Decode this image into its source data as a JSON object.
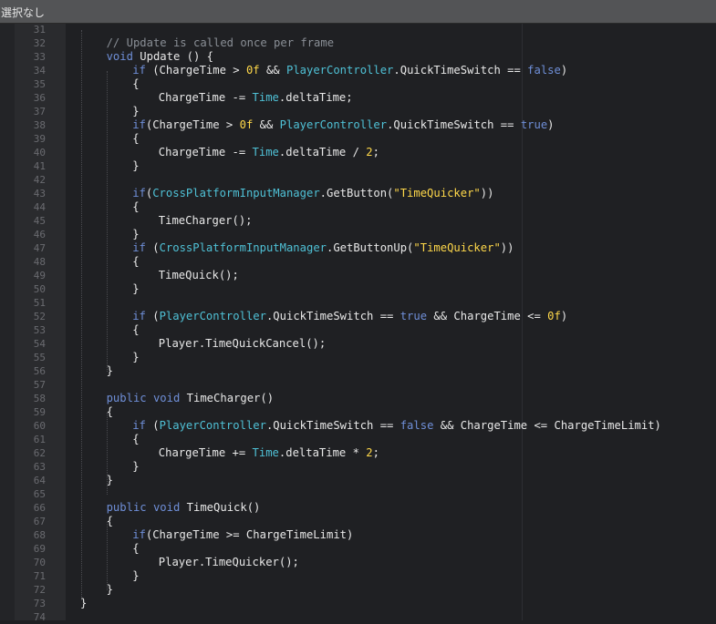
{
  "titlebar": {
    "label": "選択なし"
  },
  "editor": {
    "lines": [
      {
        "n": "31",
        "t": "",
        "indent": 0
      },
      {
        "n": "32",
        "indent": 1,
        "tokens": [
          [
            "// Update is called once per frame",
            "cm"
          ]
        ]
      },
      {
        "n": "33",
        "indent": 1,
        "tokens": [
          [
            "void",
            "kw"
          ],
          [
            " Update () {",
            ""
          ]
        ]
      },
      {
        "n": "34",
        "indent": 2,
        "tokens": [
          [
            "if",
            "kw"
          ],
          [
            " (ChargeTime > ",
            ""
          ],
          [
            "0f",
            "num"
          ],
          [
            " && ",
            ""
          ],
          [
            "PlayerController",
            "ty"
          ],
          [
            ".QuickTimeSwitch == ",
            ""
          ],
          [
            "false",
            "kw"
          ],
          [
            ")",
            ""
          ]
        ]
      },
      {
        "n": "35",
        "indent": 2,
        "tokens": [
          [
            "{",
            ""
          ]
        ]
      },
      {
        "n": "36",
        "indent": 3,
        "tokens": [
          [
            "ChargeTime -= ",
            ""
          ],
          [
            "Time",
            "ty"
          ],
          [
            ".deltaTime;",
            ""
          ]
        ]
      },
      {
        "n": "37",
        "indent": 2,
        "tokens": [
          [
            "}",
            ""
          ]
        ]
      },
      {
        "n": "38",
        "indent": 2,
        "tokens": [
          [
            "if",
            "kw"
          ],
          [
            "(ChargeTime > ",
            ""
          ],
          [
            "0f",
            "num"
          ],
          [
            " && ",
            ""
          ],
          [
            "PlayerController",
            "ty"
          ],
          [
            ".QuickTimeSwitch == ",
            ""
          ],
          [
            "true",
            "kw"
          ],
          [
            ")",
            ""
          ]
        ]
      },
      {
        "n": "39",
        "indent": 2,
        "tokens": [
          [
            "{",
            ""
          ]
        ]
      },
      {
        "n": "40",
        "indent": 3,
        "tokens": [
          [
            "ChargeTime -= ",
            ""
          ],
          [
            "Time",
            "ty"
          ],
          [
            ".deltaTime / ",
            ""
          ],
          [
            "2",
            "num"
          ],
          [
            ";",
            ""
          ]
        ]
      },
      {
        "n": "41",
        "indent": 2,
        "tokens": [
          [
            "}",
            ""
          ]
        ]
      },
      {
        "n": "42",
        "indent": 0,
        "tokens": []
      },
      {
        "n": "43",
        "indent": 2,
        "tokens": [
          [
            "if",
            "kw"
          ],
          [
            "(",
            ""
          ],
          [
            "CrossPlatformInputManager",
            "ty"
          ],
          [
            ".GetButton(",
            ""
          ],
          [
            "\"TimeQuicker\"",
            "str"
          ],
          [
            "))",
            ""
          ]
        ]
      },
      {
        "n": "44",
        "indent": 2,
        "tokens": [
          [
            "{",
            ""
          ]
        ]
      },
      {
        "n": "45",
        "indent": 3,
        "tokens": [
          [
            "TimeCharger();",
            ""
          ]
        ]
      },
      {
        "n": "46",
        "indent": 2,
        "tokens": [
          [
            "}",
            ""
          ]
        ]
      },
      {
        "n": "47",
        "indent": 2,
        "tokens": [
          [
            "if",
            "kw"
          ],
          [
            " (",
            ""
          ],
          [
            "CrossPlatformInputManager",
            "ty"
          ],
          [
            ".GetButtonUp(",
            ""
          ],
          [
            "\"TimeQuicker\"",
            "str"
          ],
          [
            "))",
            ""
          ]
        ]
      },
      {
        "n": "48",
        "indent": 2,
        "tokens": [
          [
            "{",
            ""
          ]
        ]
      },
      {
        "n": "49",
        "indent": 3,
        "tokens": [
          [
            "TimeQuick();",
            ""
          ]
        ]
      },
      {
        "n": "50",
        "indent": 2,
        "tokens": [
          [
            "}",
            ""
          ]
        ]
      },
      {
        "n": "51",
        "indent": 0,
        "tokens": []
      },
      {
        "n": "52",
        "indent": 2,
        "tokens": [
          [
            "if",
            "kw"
          ],
          [
            " (",
            ""
          ],
          [
            "PlayerController",
            "ty"
          ],
          [
            ".QuickTimeSwitch == ",
            ""
          ],
          [
            "true",
            "kw"
          ],
          [
            " && ChargeTime <= ",
            ""
          ],
          [
            "0f",
            "num"
          ],
          [
            ")",
            ""
          ]
        ]
      },
      {
        "n": "53",
        "indent": 2,
        "tokens": [
          [
            "{",
            ""
          ]
        ]
      },
      {
        "n": "54",
        "indent": 3,
        "tokens": [
          [
            "Player.TimeQuickCancel();",
            ""
          ]
        ]
      },
      {
        "n": "55",
        "indent": 2,
        "tokens": [
          [
            "}",
            ""
          ]
        ]
      },
      {
        "n": "56",
        "indent": 1,
        "tokens": [
          [
            "}",
            ""
          ]
        ]
      },
      {
        "n": "57",
        "indent": 0,
        "tokens": []
      },
      {
        "n": "58",
        "indent": 1,
        "tokens": [
          [
            "public",
            "kw"
          ],
          [
            " ",
            ""
          ],
          [
            "void",
            "kw"
          ],
          [
            " TimeCharger()",
            ""
          ]
        ]
      },
      {
        "n": "59",
        "indent": 1,
        "tokens": [
          [
            "{",
            ""
          ]
        ]
      },
      {
        "n": "60",
        "indent": 2,
        "tokens": [
          [
            "if",
            "kw"
          ],
          [
            " (",
            ""
          ],
          [
            "PlayerController",
            "ty"
          ],
          [
            ".QuickTimeSwitch == ",
            ""
          ],
          [
            "false",
            "kw"
          ],
          [
            " && ChargeTime <= ChargeTimeLimit)",
            ""
          ]
        ]
      },
      {
        "n": "61",
        "indent": 2,
        "tokens": [
          [
            "{",
            ""
          ]
        ]
      },
      {
        "n": "62",
        "indent": 3,
        "tokens": [
          [
            "ChargeTime += ",
            ""
          ],
          [
            "Time",
            "ty"
          ],
          [
            ".deltaTime * ",
            ""
          ],
          [
            "2",
            "num"
          ],
          [
            ";",
            ""
          ]
        ]
      },
      {
        "n": "63",
        "indent": 2,
        "tokens": [
          [
            "}",
            ""
          ]
        ]
      },
      {
        "n": "64",
        "indent": 1,
        "tokens": [
          [
            "}",
            ""
          ]
        ]
      },
      {
        "n": "65",
        "indent": 0,
        "tokens": []
      },
      {
        "n": "66",
        "indent": 1,
        "tokens": [
          [
            "public",
            "kw"
          ],
          [
            " ",
            ""
          ],
          [
            "void",
            "kw"
          ],
          [
            " TimeQuick()",
            ""
          ]
        ]
      },
      {
        "n": "67",
        "indent": 1,
        "tokens": [
          [
            "{",
            ""
          ]
        ]
      },
      {
        "n": "68",
        "indent": 2,
        "tokens": [
          [
            "if",
            "kw"
          ],
          [
            "(ChargeTime >= ChargeTimeLimit)",
            ""
          ]
        ]
      },
      {
        "n": "69",
        "indent": 2,
        "tokens": [
          [
            "{",
            ""
          ]
        ]
      },
      {
        "n": "70",
        "indent": 3,
        "tokens": [
          [
            "Player.TimeQuicker();",
            ""
          ]
        ]
      },
      {
        "n": "71",
        "indent": 2,
        "tokens": [
          [
            "}",
            ""
          ]
        ]
      },
      {
        "n": "72",
        "indent": 1,
        "tokens": [
          [
            "}",
            ""
          ]
        ]
      },
      {
        "n": "73",
        "indent": 0,
        "tokens": [
          [
            "}",
            ""
          ]
        ]
      },
      {
        "n": "74",
        "indent": 0,
        "tokens": []
      }
    ]
  }
}
